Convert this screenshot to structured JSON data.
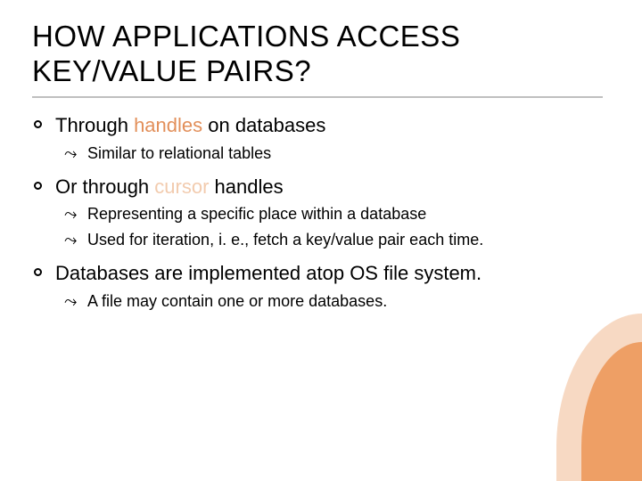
{
  "title_line1": "HOW APPLICATIONS ACCESS",
  "title_line2": "KEY/VALUE PAIRS?",
  "bullets": [
    {
      "text_pre": "Through ",
      "text_accent": "handles",
      "text_post": " on databases",
      "sub": [
        {
          "text": "Similar to relational tables"
        }
      ]
    },
    {
      "text_pre": "Or through ",
      "text_accent_light": "cursor",
      "text_post": " handles",
      "sub": [
        {
          "text": "Representing a specific place within a database"
        },
        {
          "text": "Used for iteration, i. e., fetch a key/value pair each time."
        }
      ]
    },
    {
      "text_pre": "Databases are implemented atop OS file system.",
      "sub": [
        {
          "text": "A file may contain one or more databases."
        }
      ]
    }
  ],
  "sub_bullet_glyph": "༊"
}
